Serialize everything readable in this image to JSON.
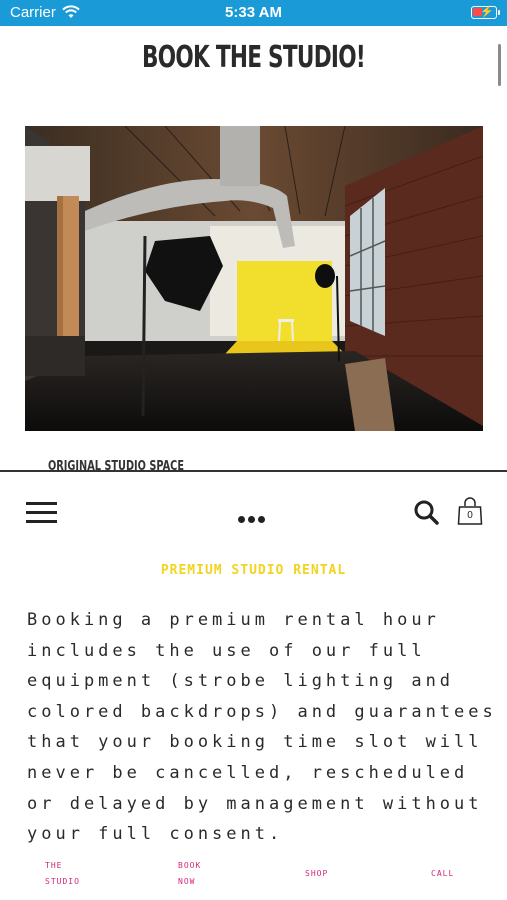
{
  "status_bar": {
    "carrier": "Carrier",
    "time": "5:33 AM",
    "icons": [
      "wifi-icon",
      "battery-charging-icon"
    ],
    "battery_color": "#ff4a4a",
    "background_color": "#1a9ad6"
  },
  "header": {
    "title": "BOOK THE STUDIO!"
  },
  "gallery": {
    "image": "studio-photo-yellow-backdrop",
    "caption": "ORIGINAL STUDIO SPACE"
  },
  "nav": {
    "icons": [
      "menu-icon",
      "more-icon",
      "search-icon",
      "shopping-bag-icon"
    ],
    "cart_count": "0"
  },
  "content": {
    "heading": "PREMIUM STUDIO RENTAL",
    "heading_color": "#f2d41f",
    "body_lines": [
      "Booking a premium rental hour",
      "includes the use of our full",
      "equipment (strobe lighting and",
      "colored backdrops) and guarantees",
      "that your booking time slot will",
      "never be cancelled, rescheduled",
      "or delayed by management without",
      "your full consent."
    ]
  },
  "bottom_links": {
    "color": "#d4287a",
    "items": [
      {
        "line1": "THE",
        "line2": "STUDIO"
      },
      {
        "line1": "BOOK",
        "line2": "NOW"
      },
      {
        "line1": "SHOP",
        "line2": ""
      },
      {
        "line1": "CALL",
        "line2": ""
      }
    ]
  }
}
